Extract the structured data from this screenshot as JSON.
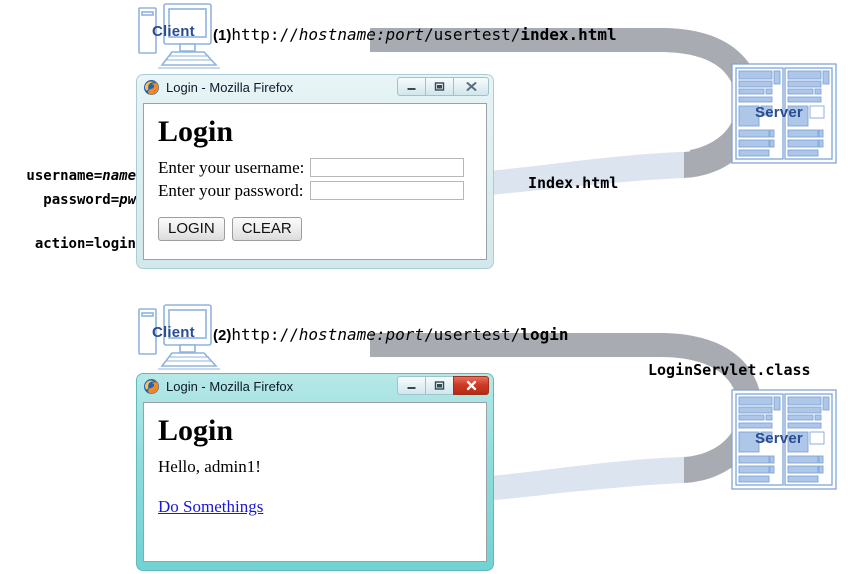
{
  "diagram": {
    "title": "Servlet request/response flow",
    "colors": {
      "request_arrow": "#a8abb2",
      "response_arrow": "#dbe4ef",
      "device_blue": "#2a4d91",
      "link_blue": "#1a16d8",
      "active_title": "#72d2d4",
      "close_red": "#cf3a25"
    }
  },
  "flows": [
    {
      "id": "flow-1",
      "step_label": "(1)",
      "url_parts": {
        "scheme": "http://",
        "host": "hostname:port",
        "path": "/usertest/",
        "resource": "index.html"
      },
      "request_label": "(1) http://hostname:port/usertest/index.html",
      "response_label": "Index.html",
      "client_label": "Client",
      "server_label": "Server"
    },
    {
      "id": "flow-2",
      "step_label": "(2)",
      "url_parts": {
        "scheme": "http://",
        "host": "hostname:port",
        "path": "/usertest/",
        "resource": "login"
      },
      "request_label": "(2) http://hostname:port/usertest/login",
      "response_label": "LoginServlet.class",
      "client_label": "Client",
      "server_label": "Server"
    }
  ],
  "form_params": [
    {
      "name": "username=",
      "value": "name"
    },
    {
      "name": "password=",
      "value": "pw"
    },
    {
      "name": "action=",
      "value": "login"
    }
  ],
  "windows": {
    "login_form": {
      "title": "Login - Mozilla Firefox",
      "state": "inactive",
      "buttons": {
        "minimize": "–",
        "maximize": "❐",
        "close": "✕"
      },
      "page": {
        "heading": "Login",
        "fields": [
          {
            "label": "Enter your username:",
            "value": "",
            "placeholder": ""
          },
          {
            "label": "Enter your password:",
            "value": "",
            "placeholder": ""
          }
        ],
        "actions": [
          {
            "label": "LOGIN"
          },
          {
            "label": "CLEAR"
          }
        ]
      }
    },
    "login_result": {
      "title": "Login - Mozilla Firefox",
      "state": "active",
      "buttons": {
        "minimize": "–",
        "maximize": "❐",
        "close": "✕"
      },
      "page": {
        "heading": "Login",
        "greeting": "Hello, admin1!",
        "link": "Do Somethings"
      }
    }
  }
}
